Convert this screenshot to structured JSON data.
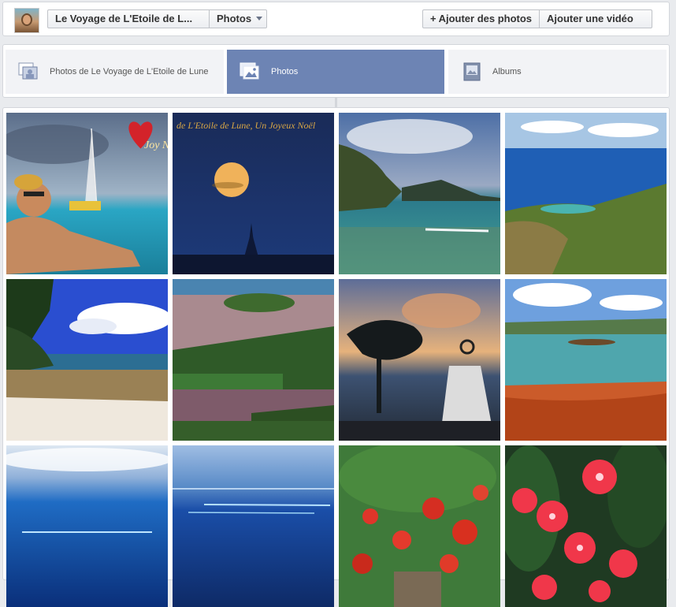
{
  "header": {
    "page_name": "Le Voyage de L'Etoile de L...",
    "section_dropdown": "Photos",
    "add_photos": "Ajouter des photos",
    "add_video": "Ajouter une vidéo"
  },
  "tabs": [
    {
      "label": "Photos de Le Voyage de L'Etoile de Lune",
      "active": false
    },
    {
      "label": "Photos",
      "active": true
    },
    {
      "label": "Albums",
      "active": false
    }
  ],
  "photos": [
    {
      "subject": "woman in lagoon with sailboat and heart",
      "overlay_text": "Joy No"
    },
    {
      "subject": "full moon over ocean at night",
      "overlay_text": "de L'Etoile de Lune, Un Joyeux Noël"
    },
    {
      "subject": "rocky coastal cliff and reef"
    },
    {
      "subject": "aerial view of green coast and blue sea"
    },
    {
      "subject": "palm trees over sandy beach"
    },
    {
      "subject": "small island in pink lagoon"
    },
    {
      "subject": "monument and tree at sunset"
    },
    {
      "subject": "turquoise bay with red earth"
    },
    {
      "subject": "ocean horizon with reef"
    },
    {
      "subject": "deep blue sea with reef line"
    },
    {
      "subject": "red flame tree flowers"
    },
    {
      "subject": "red flowers close-up"
    }
  ],
  "colors": {
    "active_tab": "#6d84b4",
    "page_bg": "#e9ebee"
  }
}
